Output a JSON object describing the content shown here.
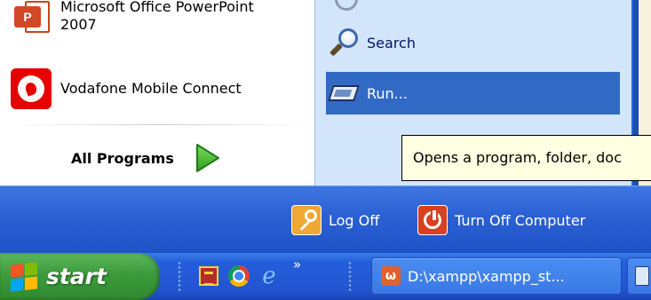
{
  "start_menu": {
    "pinned_programs": [
      {
        "name_line1": "Microsoft Office PowerPoint",
        "name_line2": "2007",
        "icon": "powerpoint-icon"
      },
      {
        "name": "Vodafone Mobile Connect",
        "icon": "vodafone-icon"
      }
    ],
    "all_programs_label": "All Programs",
    "right_items": [
      {
        "label": "Search",
        "icon": "search-icon"
      },
      {
        "label": "Run...",
        "icon": "run-icon",
        "highlighted": true
      }
    ],
    "tooltip": "Opens a program, folder, doc",
    "log_off_label": "Log Off",
    "turn_off_label": "Turn Off Computer"
  },
  "taskbar": {
    "start_label": "start",
    "quick_launch": [
      "winrar-icon",
      "chrome-icon",
      "internet-explorer-icon"
    ],
    "overflow_chevron": "»",
    "task_button_label": "D:\\xampp\\xampp_st...",
    "ie_glyph": "e"
  },
  "colors": {
    "highlight": "#316ac5",
    "right_pane": "#d3e5fa",
    "taskbar": "#245edb",
    "start_button": "#3c9a3c",
    "tooltip_bg": "#ffffe1"
  }
}
